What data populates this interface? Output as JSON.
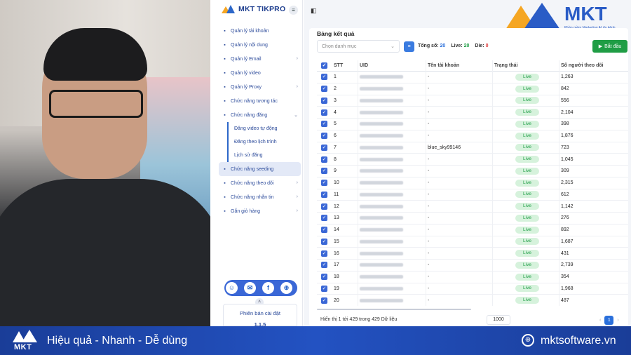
{
  "brand": {
    "name": "MKT TIKPRO"
  },
  "logo": {
    "word": "MKT",
    "tagline": "Phần mềm Marketing AI đa kênh"
  },
  "sidebar": {
    "items": [
      {
        "label": "Quản lý tài khoản",
        "icon": "grid-icon",
        "chevron": false
      },
      {
        "label": "Quản lý nội dung",
        "icon": "link-icon",
        "chevron": false
      },
      {
        "label": "Quản lý Email",
        "icon": "mail-icon",
        "chevron": true
      },
      {
        "label": "Quản lý video",
        "icon": "video-icon",
        "chevron": false
      },
      {
        "label": "Quản lý Proxy",
        "icon": "proxy-icon",
        "chevron": true
      },
      {
        "label": "Chức năng tương tác",
        "icon": "interact-icon",
        "chevron": false
      },
      {
        "label": "Chức năng đăng",
        "icon": "post-icon",
        "chevron": true
      }
    ],
    "sub_items": [
      {
        "label": "Đăng video tự động"
      },
      {
        "label": "Đăng theo lịch trình"
      },
      {
        "label": "Lịch sử đăng"
      }
    ],
    "items_after": [
      {
        "label": "Chức năng seeding",
        "icon": "seeding-icon",
        "chevron": false,
        "active": true
      },
      {
        "label": "Chức năng theo dõi",
        "icon": "follow-icon",
        "chevron": true
      },
      {
        "label": "Chức năng nhắn tin",
        "icon": "chat-icon",
        "chevron": true
      },
      {
        "label": "Gắn giỏ hàng",
        "icon": "cart-icon",
        "chevron": true
      }
    ],
    "version_label": "Phiên bản cài đặt",
    "version_number": "1.1.5"
  },
  "card": {
    "title": "Bảng kết quả",
    "select_placeholder": "Chọn danh mục",
    "stats": {
      "total_label": "Tổng số:",
      "total": "20",
      "live_label": "Live:",
      "live": "20",
      "die_label": "Die:",
      "die": "0"
    },
    "start_button": "Bắt đầu"
  },
  "table": {
    "headers": {
      "stt": "STT",
      "uid": "UID",
      "name": "Tên tài khoản",
      "status": "Trạng thái",
      "followers": "Số người theo dõi"
    },
    "rows": [
      {
        "stt": "1",
        "name": "-",
        "status": "Live",
        "followers": "1,263"
      },
      {
        "stt": "2",
        "name": "-",
        "status": "Live",
        "followers": "842"
      },
      {
        "stt": "3",
        "name": "-",
        "status": "Live",
        "followers": "556"
      },
      {
        "stt": "4",
        "name": "-",
        "status": "Live",
        "followers": "2,104"
      },
      {
        "stt": "5",
        "name": "-",
        "status": "Live",
        "followers": "398"
      },
      {
        "stt": "6",
        "name": "-",
        "status": "Live",
        "followers": "1,876"
      },
      {
        "stt": "7",
        "name": "blue_sky99146",
        "status": "Live",
        "followers": "723"
      },
      {
        "stt": "8",
        "name": "-",
        "status": "Live",
        "followers": "1,045"
      },
      {
        "stt": "9",
        "name": "-",
        "status": "Live",
        "followers": "309"
      },
      {
        "stt": "10",
        "name": "-",
        "status": "Live",
        "followers": "2,315"
      },
      {
        "stt": "11",
        "name": "-",
        "status": "Live",
        "followers": "612"
      },
      {
        "stt": "12",
        "name": "-",
        "status": "Live",
        "followers": "1,142"
      },
      {
        "stt": "13",
        "name": "-",
        "status": "Live",
        "followers": "276"
      },
      {
        "stt": "14",
        "name": "-",
        "status": "Live",
        "followers": "892"
      },
      {
        "stt": "15",
        "name": "-",
        "status": "Live",
        "followers": "1,687"
      },
      {
        "stt": "16",
        "name": "-",
        "status": "Live",
        "followers": "431"
      },
      {
        "stt": "17",
        "name": "-",
        "status": "Live",
        "followers": "2,739"
      },
      {
        "stt": "18",
        "name": "-",
        "status": "Live",
        "followers": "354"
      },
      {
        "stt": "19",
        "name": "-",
        "status": "Live",
        "followers": "1,968"
      },
      {
        "stt": "20",
        "name": "-",
        "status": "Live",
        "followers": "487"
      }
    ],
    "footer": "Hiển thị 1 tới 429 trong 429 Dữ liệu",
    "page_size": "1000",
    "current_page": "1"
  },
  "banner": {
    "logo": "MKT",
    "slogan": "Hiệu quả - Nhanh - Dễ dùng",
    "site": "mktsoftware.vn"
  },
  "colors": {
    "brand_blue": "#2a5cc6",
    "brand_orange": "#f5a623",
    "live_green": "#1f9d45"
  }
}
